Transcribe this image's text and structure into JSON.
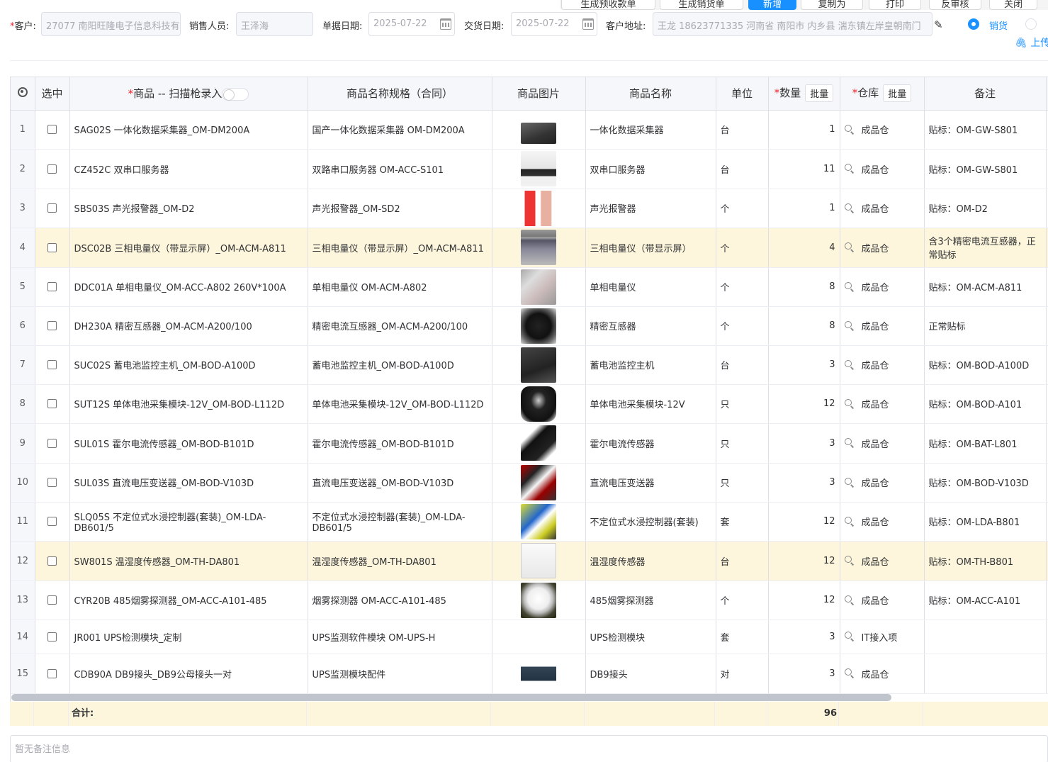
{
  "toolbar": {
    "buttons": [
      "生成预收款单",
      "生成销货单",
      "新增",
      "复制为",
      "打印",
      "反审核",
      "关闭"
    ]
  },
  "form": {
    "customer_label": "客户:",
    "customer_value": "27077 南阳旺隆电子信息科技有",
    "salesperson_label": "销售人员:",
    "salesperson_value": "王泽海",
    "doc_date_label": "单据日期:",
    "doc_date_value": "2025-07-22",
    "delivery_date_label": "交货日期:",
    "delivery_date_value": "2025-07-22",
    "address_label": "客户地址:",
    "address_value": "王龙 18623771335 河南省 南阳市 内乡县 湍东镇左岸皇朝南门",
    "radio_sale": "销货",
    "upload_label": "上传"
  },
  "table": {
    "headers": {
      "select": "选中",
      "product": "商品 -- 扫描枪录入",
      "spec": "商品名称规格（合同）",
      "image": "商品图片",
      "name": "商品名称",
      "unit": "单位",
      "qty": "数量",
      "warehouse": "仓库",
      "remark": "备注",
      "batch": "批量"
    },
    "rows": [
      {
        "idx": "1",
        "product": "SAG02S 一体化数据采集器_OM-DM200A",
        "spec": "国产一体化数据采集器 OM-DM200A",
        "name": "一体化数据采集器",
        "unit": "台",
        "qty": "1",
        "warehouse": "成品仓",
        "remark": "贴标：OM-GW-S801"
      },
      {
        "idx": "2",
        "product": "CZ452C 双串口服务器",
        "spec": "双路串口服务器 OM-ACC-S101",
        "name": "双串口服务器",
        "unit": "台",
        "qty": "11",
        "warehouse": "成品仓",
        "remark": "贴标：OM-GW-S801"
      },
      {
        "idx": "3",
        "product": "SBS03S 声光报警器_OM-D2",
        "spec": "声光报警器_OM-SD2",
        "name": "声光报警器",
        "unit": "个",
        "qty": "1",
        "warehouse": "成品仓",
        "remark": "贴标：OM-D2"
      },
      {
        "idx": "4",
        "product": "DSC02B 三相电量仪（带显示屏）_OM-ACM-A811",
        "spec": "三相电量仪（带显示屏）_OM-ACM-A811",
        "name": "三相电量仪（带显示屏）",
        "unit": "个",
        "qty": "4",
        "warehouse": "成品仓",
        "remark": "含3个精密电流互感器，正常贴标"
      },
      {
        "idx": "5",
        "product": "DDC01A 单相电量仪_OM-ACC-A802 260V*100A",
        "spec": "单相电量仪 OM-ACM-A802",
        "name": "单相电量仪",
        "unit": "个",
        "qty": "8",
        "warehouse": "成品仓",
        "remark": "贴标：OM-ACM-A811"
      },
      {
        "idx": "6",
        "product": "DH230A 精密互感器_OM-ACM-A200/100",
        "spec": "精密电流互感器_OM-ACM-A200/100",
        "name": "精密互感器",
        "unit": "个",
        "qty": "8",
        "warehouse": "成品仓",
        "remark": "正常贴标"
      },
      {
        "idx": "7",
        "product": "SUC02S 蓄电池监控主机_OM-BOD-A100D",
        "spec": "蓄电池监控主机_OM-BOD-A100D",
        "name": "蓄电池监控主机",
        "unit": "台",
        "qty": "3",
        "warehouse": "成品仓",
        "remark": "贴标：OM-BOD-A100D"
      },
      {
        "idx": "8",
        "product": "SUT12S 单体电池采集模块-12V_OM-BOD-L112D",
        "spec": "单体电池采集模块-12V_OM-BOD-L112D",
        "name": "单体电池采集模块-12V",
        "unit": "只",
        "qty": "12",
        "warehouse": "成品仓",
        "remark": "贴标：OM-BOD-A101"
      },
      {
        "idx": "9",
        "product": "SUL01S 霍尔电流传感器_OM-BOD-B101D",
        "spec": "霍尔电流传感器_OM-BOD-B101D",
        "name": "霍尔电流传感器",
        "unit": "只",
        "qty": "3",
        "warehouse": "成品仓",
        "remark": "贴标：OM-BAT-L801"
      },
      {
        "idx": "10",
        "product": "SUL03S 直流电压变送器_OM-BOD-V103D",
        "spec": "直流电压变送器_OM-BOD-V103D",
        "name": "直流电压变送器",
        "unit": "只",
        "qty": "3",
        "warehouse": "成品仓",
        "remark": "贴标：OM-BOD-V103D"
      },
      {
        "idx": "11",
        "product": "SLQ05S 不定位式水浸控制器(套装)_OM-LDA-DB601/5",
        "spec": "不定位式水浸控制器(套装)_OM-LDA-DB601/5",
        "name": "不定位式水浸控制器(套装)",
        "unit": "套",
        "qty": "12",
        "warehouse": "成品仓",
        "remark": "贴标：OM-LDA-B801"
      },
      {
        "idx": "12",
        "product": "SW801S 温湿度传感器_OM-TH-DA801",
        "spec": "温湿度传感器_OM-TH-DA801",
        "name": "温湿度传感器",
        "unit": "台",
        "qty": "12",
        "warehouse": "成品仓",
        "remark": "贴标：OM-TH-B801"
      },
      {
        "idx": "13",
        "product": "CYR20B 485烟雾探测器_OM-ACC-A101-485",
        "spec": "烟雾探测器 OM-ACC-A101-485",
        "name": "485烟雾探测器",
        "unit": "个",
        "qty": "12",
        "warehouse": "成品仓",
        "remark": "贴标：OM-ACC-A101"
      },
      {
        "idx": "14",
        "product": "JR001 UPS检测模块_定制",
        "spec": "UPS监测软件模块 OM-UPS-H",
        "name": "UPS检测模块",
        "unit": "套",
        "qty": "3",
        "warehouse": "IT接入项",
        "remark": ""
      },
      {
        "idx": "15",
        "product": "CDB90A DB9接头_DB9公母接头一对",
        "spec": "UPS监测模块配件",
        "name": "DB9接头",
        "unit": "对",
        "qty": "3",
        "warehouse": "成品仓",
        "remark": ""
      }
    ],
    "total_label": "合计:",
    "total_qty": "96"
  },
  "remark_placeholder": "暂无备注信息",
  "colors": {
    "primary": "#1890ff",
    "highlight_row": "#fdf6dc",
    "required": "#f5222d"
  }
}
